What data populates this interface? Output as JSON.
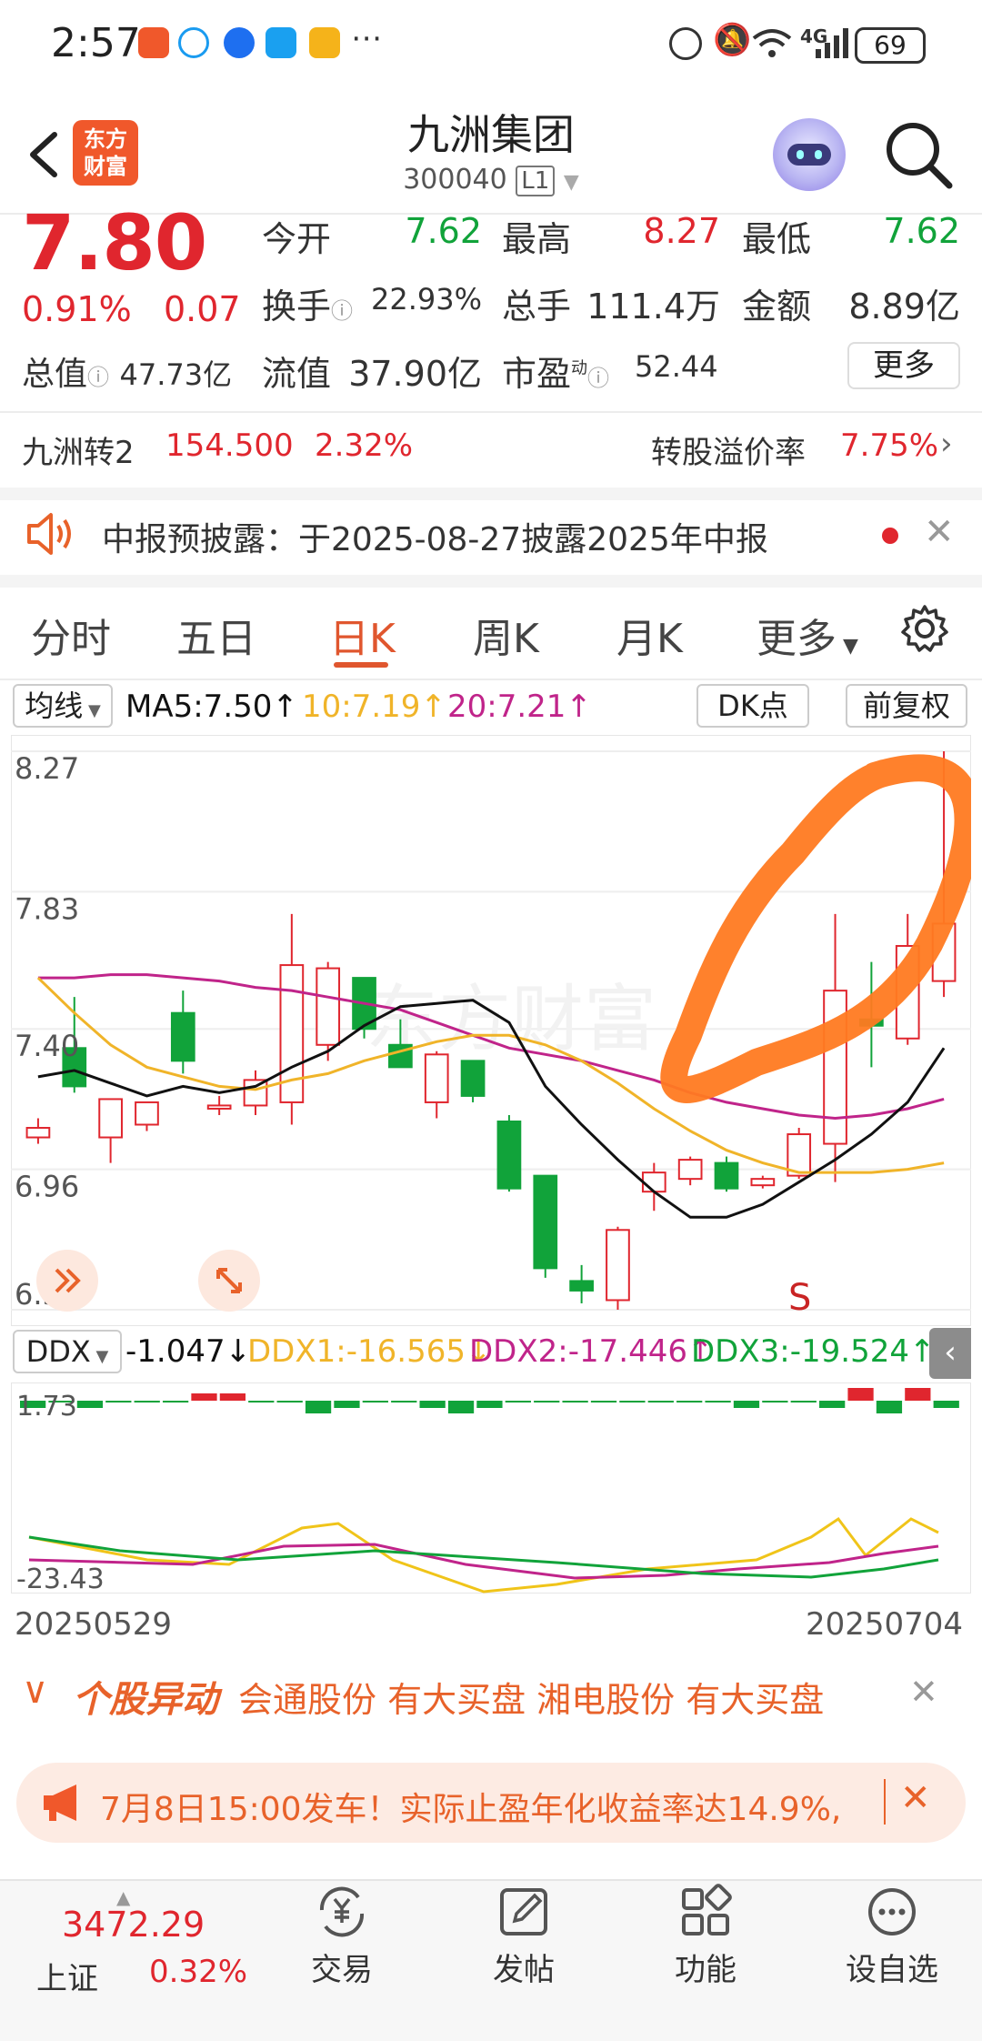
{
  "status_bar": {
    "time": "2:57",
    "battery": "69",
    "network": "4G"
  },
  "header": {
    "stock_name": "九洲集团",
    "stock_code": "300040",
    "level_badge": "L1",
    "logo_line1": "东方",
    "logo_line2": "财富"
  },
  "quote": {
    "price": "7.80",
    "change_pct": "0.91%",
    "change_amt": "0.07",
    "open_label": "今开",
    "open": "7.62",
    "high_label": "最高",
    "high": "8.27",
    "low_label": "最低",
    "low": "7.62",
    "turnover_label": "换手",
    "turnover": "22.93%",
    "volume_label": "总手",
    "volume": "111.4万",
    "amount_label": "金额",
    "amount": "8.89亿",
    "mcap_label": "总值",
    "mcap": "47.73亿",
    "float_label": "流值",
    "float_cap": "37.90亿",
    "pe_label": "市盈",
    "pe_sup": "动",
    "pe": "52.44",
    "more_label": "更多"
  },
  "bond": {
    "name": "九洲转2",
    "price": "154.500",
    "change": "2.32%",
    "premium_label": "转股溢价率",
    "premium": "7.75%"
  },
  "notice": {
    "text": "中报预披露：于2025-08-27披露2025年中报"
  },
  "tabs": [
    "分时",
    "五日",
    "日K",
    "周K",
    "月K",
    "更多"
  ],
  "active_tab": "日K",
  "ma_bar": {
    "selector": "均线",
    "ma5": "MA5:7.50↑",
    "ma10": "10:7.19↑",
    "ma20": "20:7.21↑",
    "dk_button": "DK点",
    "adjust_button": "前复权"
  },
  "y_axis_labels": [
    "8.27",
    "7.83",
    "7.40",
    "6.96",
    "6.52"
  ],
  "signal_label": "S",
  "ddx_bar": {
    "selector": "DDX",
    "ddx": "-1.047↓",
    "ddx1": "DDX1:-16.565↓",
    "ddx2": "DDX2:-17.446↑",
    "ddx3": "DDX3:-19.524↑"
  },
  "ddx_axis": {
    "top": "1.73",
    "bottom": "-23.43"
  },
  "date_range": {
    "start": "20250529",
    "end": "20250704"
  },
  "ticker": {
    "title": "个股异动",
    "text": "会通股份  有大买盘  湘电股份  有大买盘"
  },
  "ad_banner": {
    "text": "7月8日15:00发车！实际止盈年化收益率达14.9%,"
  },
  "bottom_bar": {
    "index_value": "3472.29",
    "index_name": "上证",
    "index_change": "0.32%",
    "items": [
      "交易",
      "发帖",
      "功能",
      "设自选"
    ]
  },
  "colors": {
    "up": "#e0262e",
    "down": "#11a33a",
    "ma5": "#111111",
    "ma10": "#f0b429",
    "ma20": "#c0248a",
    "brand": "#f0582b",
    "annotation": "#ff7a21"
  },
  "chart_data": {
    "type": "candlestick",
    "candles": [
      {
        "o": 7.06,
        "h": 7.12,
        "l": 7.04,
        "c": 7.09
      },
      {
        "o": 7.34,
        "h": 7.5,
        "l": 7.2,
        "c": 7.22
      },
      {
        "o": 7.06,
        "h": 7.16,
        "l": 6.98,
        "c": 7.18
      },
      {
        "o": 7.1,
        "h": 7.16,
        "l": 7.08,
        "c": 7.17
      },
      {
        "o": 7.45,
        "h": 7.52,
        "l": 7.26,
        "c": 7.3
      },
      {
        "o": 7.15,
        "h": 7.19,
        "l": 7.13,
        "c": 7.16
      },
      {
        "o": 7.16,
        "h": 7.27,
        "l": 7.13,
        "c": 7.24
      },
      {
        "o": 7.17,
        "h": 7.76,
        "l": 7.1,
        "c": 7.6
      },
      {
        "o": 7.35,
        "h": 7.61,
        "l": 7.3,
        "c": 7.59
      },
      {
        "o": 7.56,
        "h": 7.56,
        "l": 7.37,
        "c": 7.4
      },
      {
        "o": 7.35,
        "h": 7.43,
        "l": 7.28,
        "c": 7.28
      },
      {
        "o": 7.17,
        "h": 7.33,
        "l": 7.12,
        "c": 7.32
      },
      {
        "o": 7.3,
        "h": 7.3,
        "l": 7.17,
        "c": 7.19
      },
      {
        "o": 7.11,
        "h": 7.13,
        "l": 6.89,
        "c": 6.9
      },
      {
        "o": 6.94,
        "h": 6.94,
        "l": 6.62,
        "c": 6.65
      },
      {
        "o": 6.61,
        "h": 6.66,
        "l": 6.54,
        "c": 6.58
      },
      {
        "o": 6.55,
        "h": 6.78,
        "l": 6.52,
        "c": 6.77
      },
      {
        "o": 6.89,
        "h": 6.98,
        "l": 6.83,
        "c": 6.95
      },
      {
        "o": 6.93,
        "h": 7.0,
        "l": 6.91,
        "c": 6.99
      },
      {
        "o": 6.98,
        "h": 7.0,
        "l": 6.89,
        "c": 6.9
      },
      {
        "o": 6.91,
        "h": 6.94,
        "l": 6.9,
        "c": 6.93
      },
      {
        "o": 6.94,
        "h": 7.09,
        "l": 6.93,
        "c": 7.07
      },
      {
        "o": 7.04,
        "h": 7.76,
        "l": 6.92,
        "c": 7.52
      },
      {
        "o": 7.43,
        "h": 7.61,
        "l": 7.28,
        "c": 7.41
      },
      {
        "o": 7.37,
        "h": 7.76,
        "l": 7.35,
        "c": 7.66
      },
      {
        "o": 7.55,
        "h": 8.27,
        "l": 7.5,
        "c": 7.73
      }
    ],
    "ma5": [
      7.25,
      7.27,
      7.23,
      7.19,
      7.22,
      7.2,
      7.22,
      7.28,
      7.33,
      7.41,
      7.47,
      7.48,
      7.49,
      7.42,
      7.22,
      7.1,
      6.99,
      6.89,
      6.81,
      6.81,
      6.85,
      6.92,
      6.99,
      7.07,
      7.17,
      7.34
    ],
    "ma10": [
      7.56,
      7.45,
      7.35,
      7.28,
      7.25,
      7.22,
      7.21,
      7.24,
      7.26,
      7.3,
      7.33,
      7.36,
      7.38,
      7.38,
      7.35,
      7.3,
      7.23,
      7.15,
      7.08,
      7.02,
      6.98,
      6.95,
      6.95,
      6.95,
      6.96,
      6.98
    ],
    "ma20": [
      7.56,
      7.56,
      7.57,
      7.57,
      7.56,
      7.55,
      7.53,
      7.52,
      7.5,
      7.48,
      7.46,
      7.42,
      7.38,
      7.34,
      7.32,
      7.3,
      7.27,
      7.24,
      7.2,
      7.17,
      7.15,
      7.13,
      7.12,
      7.13,
      7.15,
      7.18
    ],
    "ylim": [
      6.52,
      8.27
    ],
    "y_ticks": [
      8.27,
      7.83,
      7.4,
      6.96,
      6.52
    ],
    "x_range": [
      "20250529",
      "20250704"
    ]
  }
}
